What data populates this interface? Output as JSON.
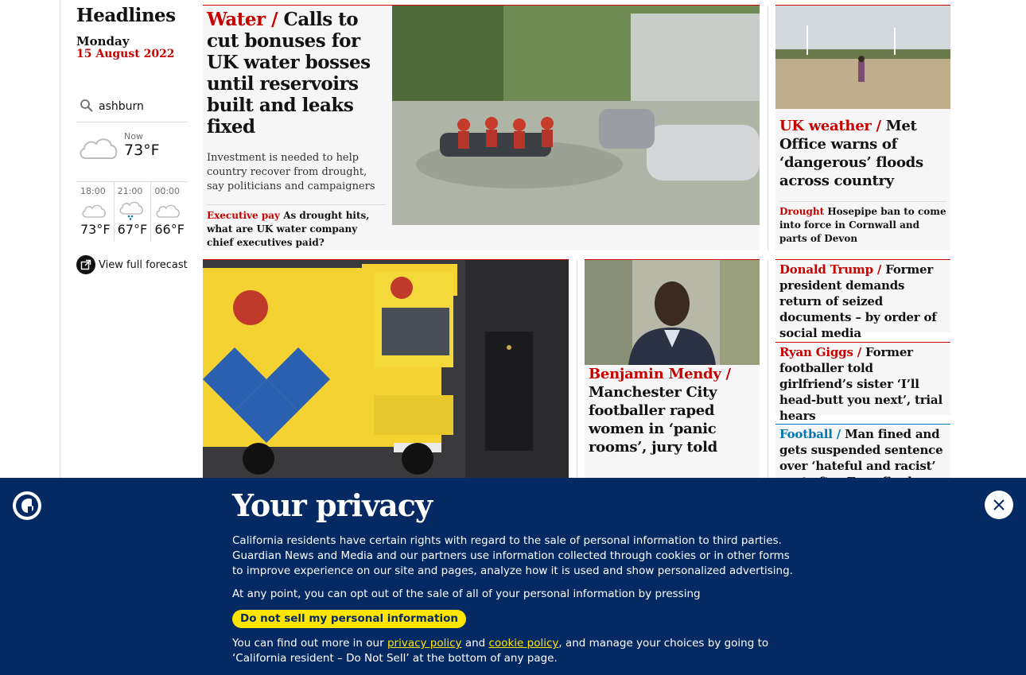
{
  "sidebar": {
    "title": "Headlines",
    "day": "Monday",
    "date": "15 August 2022",
    "weather": {
      "location": "ashburn",
      "now_label": "Now",
      "now_temp": "73°F",
      "forecast": [
        {
          "time": "18:00",
          "temp": "73°F",
          "icon": "cloud-icon"
        },
        {
          "time": "21:00",
          "temp": "67°F",
          "icon": "rain-cloud-icon"
        },
        {
          "time": "00:00",
          "temp": "66°F",
          "icon": "cloud-icon"
        }
      ],
      "full_forecast": "View full forecast"
    }
  },
  "main_story": {
    "kicker": "Water /",
    "headline": "Calls to cut bonuses for UK water bosses until reservoirs built and leaks fixed",
    "standfirst": "Investment is needed to help country recover from drought, say politicians and campaigners",
    "sub_kicker": "Executive pay",
    "sub_headline": "As drought hits, what are UK water company chief executives paid?"
  },
  "side_story": {
    "kicker": "UK weather /",
    "headline": "Met Office warns of ‘dangerous’ floods across country",
    "sub_kicker": "Drought",
    "sub_headline": "Hosepipe ban to come into force in Cornwall and parts of Devon"
  },
  "mendy_story": {
    "kicker": "Benjamin Mendy /",
    "headline": "Manchester City footballer raped women in ‘panic rooms’, jury told"
  },
  "trump_story": {
    "kicker": "Donald Trump /",
    "headline": "Former president demands return of seized documents – by order of social media"
  },
  "giggs_story": {
    "kicker": "Ryan Giggs /",
    "headline": "Former footballer told girlfriend’s sister ‘I’ll head-butt you next’, trial hears"
  },
  "football_story": {
    "kicker": "Football /",
    "headline": "Man fined and gets suspended sentence over ‘hateful and racist’ post after Euro final"
  },
  "privacy": {
    "title": "Your privacy",
    "para1": "California residents have certain rights with regard to the sale of personal information to third parties. Guardian News and Media and our partners use information collected through cookies or in other forms to improve experience on our site and pages, analyze how it is used and show personalized advertising.",
    "para2": "At any point, you can opt out of the sale of all of your personal information by pressing",
    "button": "Do not sell my personal information",
    "para3_a": "You can find out more in our ",
    "privacy_link": "privacy policy",
    "para3_b": " and ",
    "cookie_link": "cookie policy",
    "para3_c": ", and manage your choices by going to ‘California resident – Do Not Sell’ at the bottom of any page."
  },
  "colors": {
    "news_red": "#c70000",
    "sport_blue": "#0077b6",
    "banner_navy": "#052962",
    "button_yellow": "#ffe500"
  }
}
